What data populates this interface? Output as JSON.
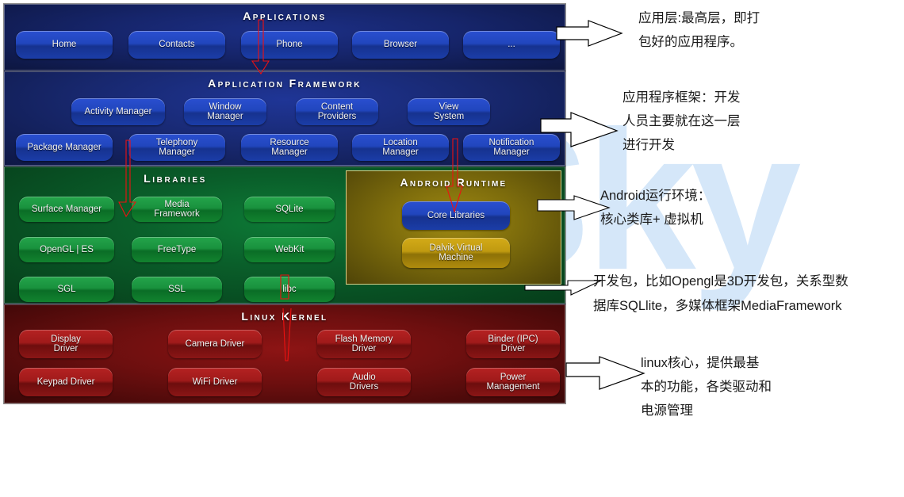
{
  "watermark": "pureSky",
  "diagram": {
    "layers": [
      {
        "id": "applications",
        "title": "Applications",
        "items": [
          "Home",
          "Contacts",
          "Phone",
          "Browser",
          "..."
        ]
      },
      {
        "id": "framework",
        "title": "Application Framework",
        "row1": [
          "Activity Manager",
          "Window\nManager",
          "Content\nProviders",
          "View\nSystem"
        ],
        "row2": [
          "Package Manager",
          "Telephony\nManager",
          "Resource\nManager",
          "Location\nManager",
          "Notification\nManager"
        ]
      },
      {
        "id": "libraries",
        "title": "Libraries",
        "col1": [
          "Surface Manager",
          "OpenGL | ES",
          "SGL"
        ],
        "col2": [
          "Media\nFramework",
          "FreeType",
          "SSL"
        ],
        "col3": [
          "SQLite",
          "WebKit",
          "libc"
        ]
      },
      {
        "id": "runtime",
        "title": "Android Runtime",
        "items": [
          "Core Libraries",
          "Dalvik Virtual\nMachine"
        ]
      },
      {
        "id": "kernel",
        "title": "Linux Kernel",
        "row1": [
          "Display\nDriver",
          "Camera Driver",
          "Flash Memory\nDriver",
          "Binder (IPC)\nDriver"
        ],
        "row2": [
          "Keypad Driver",
          "WiFi Driver",
          "Audio\nDrivers",
          "Power\nManagement"
        ]
      }
    ]
  },
  "notes": [
    {
      "id": "note-applications",
      "text": "应用层:最高层，即打\n包好的应用程序。"
    },
    {
      "id": "note-framework",
      "text": "应用程序框架：开发\n人员主要就在这一层\n进行开发"
    },
    {
      "id": "note-runtime",
      "text": "Android运行环境：\n核心类库+ 虚拟机"
    },
    {
      "id": "note-libraries",
      "text": "开发包，比如Opengl是3D开发包，关系型数\n据库SQLlite，多媒体框架MediaFramework"
    },
    {
      "id": "note-kernel",
      "text": "linux核心，提供最基\n本的功能，各类驱动和\n电源管理"
    }
  ],
  "colors": {
    "applications": "#16256b",
    "framework": "#18286f",
    "libraries": "#0a5e2a",
    "runtime": "#7d6c0c",
    "kernel": "#6d0f0f",
    "watermark": "#bcd9f6",
    "red_arrow": "#ee1111",
    "note_text": "#1a1a1a"
  }
}
